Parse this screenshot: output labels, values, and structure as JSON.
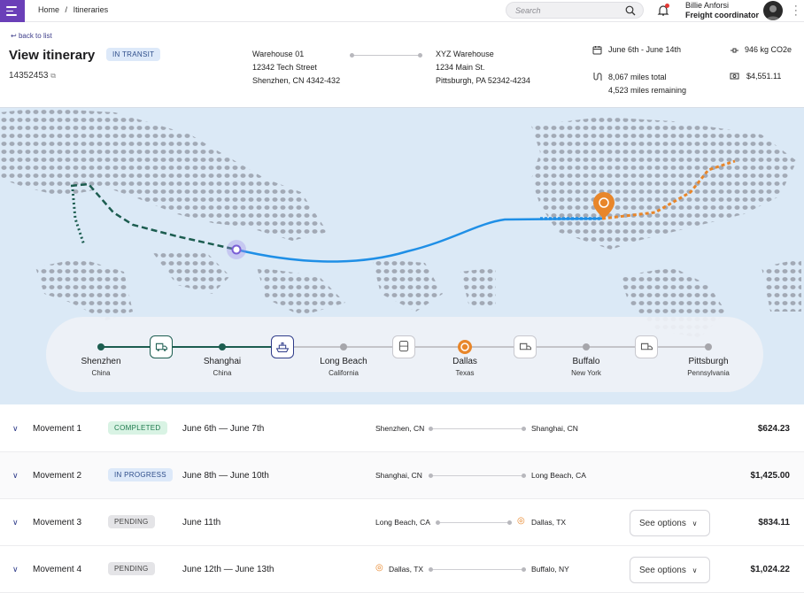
{
  "breadcrumb": {
    "home": "Home",
    "sep": "/",
    "current": "Itineraries"
  },
  "search": {
    "placeholder": "Search"
  },
  "user": {
    "name": "Billie Anforsi",
    "role": "Freight coordinator"
  },
  "page": {
    "back_label": "back to list",
    "title": "View itinerary",
    "status": "IN TRANSIT",
    "id": "14352453"
  },
  "origin": {
    "name": "Warehouse 01",
    "street": "12342 Tech Street",
    "city": "Shenzhen, CN 4342-432"
  },
  "destination": {
    "name": "XYZ Warehouse",
    "street": "1234 Main St.",
    "city": "Pittsburgh, PA 52342-4234"
  },
  "summary": {
    "dates": "June 6th - June 14th",
    "miles_total": "8,067 miles total",
    "miles_remaining": "4,523 miles remaining",
    "co2": "946 kg CO2e",
    "cost": "$4,551.11"
  },
  "timeline": {
    "stops": [
      {
        "city": "Shenzhen",
        "region": "China"
      },
      {
        "city": "Shanghai",
        "region": "China"
      },
      {
        "city": "Long Beach",
        "region": "California"
      },
      {
        "city": "Dallas",
        "region": "Texas"
      },
      {
        "city": "Buffalo",
        "region": "New York"
      },
      {
        "city": "Pittsburgh",
        "region": "Pennsylvania"
      }
    ]
  },
  "movements": [
    {
      "name": "Movement 1",
      "status": "COMPLETED",
      "dates": "June 6th — June 7th",
      "from": "Shenzhen, CN",
      "to": "Shanghai, CN",
      "price": "$624.23"
    },
    {
      "name": "Movement 2",
      "status": "IN PROGRESS",
      "dates": "June 8th — June 10th",
      "from": "Shanghai, CN",
      "to": "Long Beach, CA",
      "price": "$1,425.00"
    },
    {
      "name": "Movement 3",
      "status": "PENDING",
      "dates": "June 11th",
      "from": "Long Beach, CA",
      "to": "Dallas, TX",
      "options": "See options",
      "price": "$834.11"
    },
    {
      "name": "Movement 4",
      "status": "PENDING",
      "dates": "June 12th — June 13th",
      "from": "Dallas, TX",
      "to": "Buffalo, NY",
      "options": "See options",
      "price": "$1,024.22"
    }
  ],
  "colors": {
    "accent": "#6a3fb8",
    "route_done": "#1c5d50",
    "route_active": "#1f8fe6",
    "route_pending": "#e8862a"
  }
}
